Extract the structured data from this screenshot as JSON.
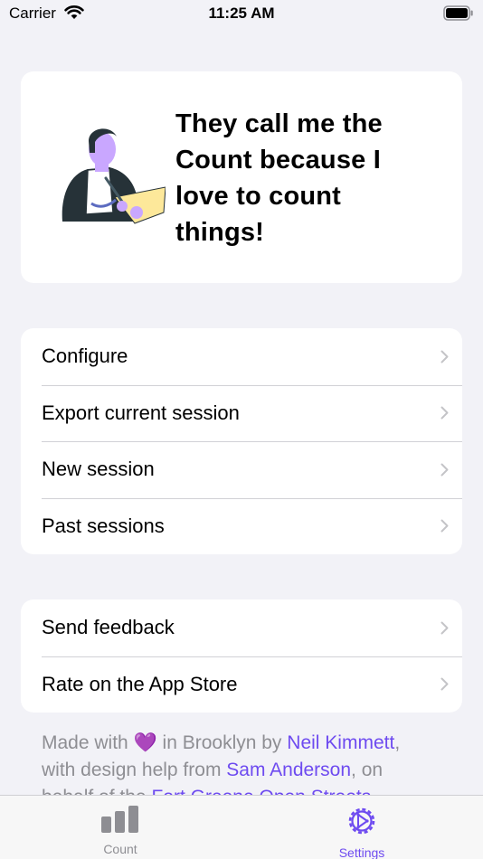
{
  "status_bar": {
    "carrier": "Carrier",
    "time": "11:25 AM"
  },
  "hero": {
    "line1": "They call me the",
    "line2": "Count because I",
    "line3": "love to count",
    "line4": "things!"
  },
  "menu": {
    "configure": "Configure",
    "export": "Export current session",
    "new_session": "New session",
    "past_sessions": "Past sessions"
  },
  "feedback": {
    "send": "Send feedback",
    "rate": "Rate on the App Store"
  },
  "footer": {
    "made_with": "Made with ",
    "heart": "💜",
    "in_brooklyn": " in Brooklyn by ",
    "author": "Neil Kimmett",
    "comma": ",",
    "design_help": "with design help from ",
    "designer": "Sam Anderson",
    "on": ", on",
    "behalf": "behalf of the ",
    "org": "Fort Greene Open Streets"
  },
  "tabs": {
    "count": "Count",
    "settings": "Settings"
  },
  "colors": {
    "accent": "#6e4bf0",
    "background": "#f2f2f7",
    "secondary_text": "#8e8e93"
  }
}
